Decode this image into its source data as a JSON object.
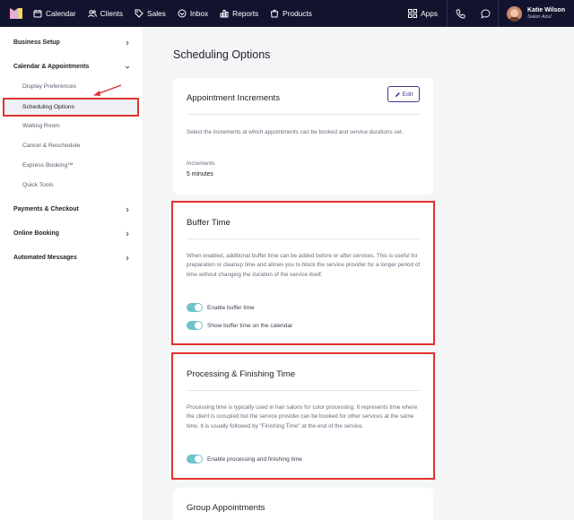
{
  "colors": {
    "nav_bg": "#12132e",
    "accent_red": "#e3332e",
    "toggle_on": "#6fc3cc",
    "brand_purple": "#3a3c8c"
  },
  "topnav": {
    "logo_icon": "brand-logo-icon",
    "items": [
      {
        "label": "Calendar",
        "icon": "calendar-icon"
      },
      {
        "label": "Clients",
        "icon": "users-icon"
      },
      {
        "label": "Sales",
        "icon": "tag-icon"
      },
      {
        "label": "Inbox",
        "icon": "inbox-icon"
      },
      {
        "label": "Reports",
        "icon": "bar-chart-icon"
      },
      {
        "label": "Products",
        "icon": "bag-icon"
      }
    ],
    "apps_label": "Apps",
    "user": {
      "name": "Katie Wilson",
      "org": "Salon Azul"
    }
  },
  "sidebar": {
    "sections": [
      {
        "label": "Business Setup",
        "expanded": false
      },
      {
        "label": "Calendar & Appointments",
        "expanded": true
      },
      {
        "label": "Payments & Checkout",
        "expanded": false
      },
      {
        "label": "Online Booking",
        "expanded": false
      },
      {
        "label": "Automated Messages",
        "expanded": false
      }
    ],
    "calendar_items": [
      "Display Preferences",
      "Scheduling Options",
      "Waiting Room",
      "Cancel & Reschedule",
      "Express Booking™",
      "Quick Tools"
    ],
    "active_item": "Scheduling Options"
  },
  "main": {
    "title": "Scheduling Options",
    "increments_card": {
      "title": "Appointment Increments",
      "edit_label": "Edit",
      "description": "Select the increments at which appointments can be booked and service durations set.",
      "field_label": "Increments",
      "field_value": "5 minutes"
    },
    "buffer_card": {
      "title": "Buffer Time",
      "description": "When enabled, additional buffer time can be added before or after services. This is useful for preparation or cleanup time and allows you to block the service provider for a longer period of time without changing the duration of the service itself.",
      "toggles": [
        {
          "label": "Enable buffer time",
          "on": true
        },
        {
          "label": "Show buffer time on the calendar",
          "on": true
        }
      ]
    },
    "processing_card": {
      "title": "Processing & Finishing Time",
      "description": "Processing time is typically used in hair salons for color processing. It represents time where the client is occupied but the service provider can be booked for other services at the same time. It is usually followed by \"Finishing Time\" at the end of the service.",
      "toggles": [
        {
          "label": "Enable processing and finishing time",
          "on": true
        }
      ]
    },
    "group_card": {
      "title": "Group Appointments"
    }
  }
}
